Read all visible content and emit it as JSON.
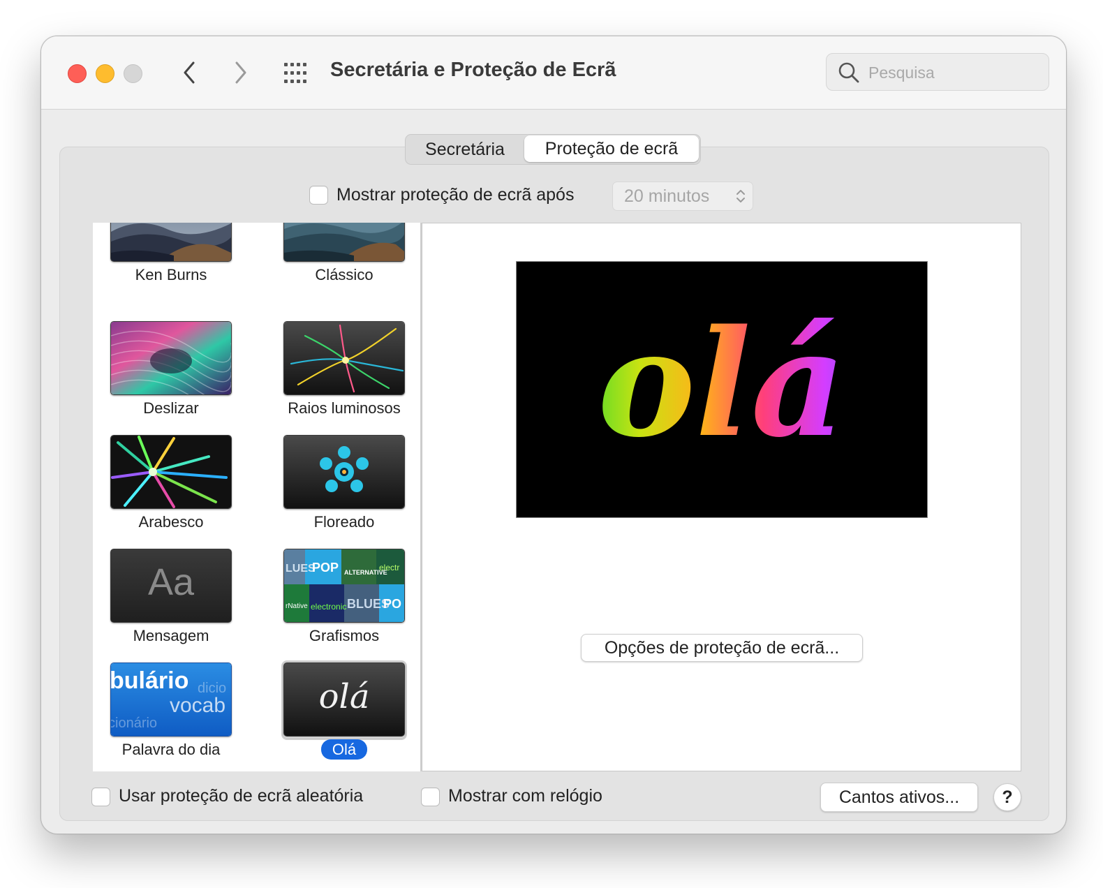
{
  "window": {
    "title": "Secretária e Proteção de Ecrã",
    "search_placeholder": "Pesquisa"
  },
  "tabs": [
    {
      "label": "Secretária",
      "selected": false
    },
    {
      "label": "Proteção de ecrã",
      "selected": true
    }
  ],
  "show_after": {
    "label": "Mostrar proteção de ecrã após",
    "checked": false,
    "select_value": "20 minutos"
  },
  "screensavers": [
    {
      "name": "Ken Burns",
      "icon": "mountain-landscape-thumbnail"
    },
    {
      "name": "Clássico",
      "icon": "mountain-landscape-thumbnail"
    },
    {
      "name": "Deslizar",
      "icon": "drift-thumbnail"
    },
    {
      "name": "Raios luminosos",
      "icon": "flurry-thumbnail"
    },
    {
      "name": "Arabesco",
      "icon": "arabesque-thumbnail"
    },
    {
      "name": "Floreado",
      "icon": "shell-thumbnail"
    },
    {
      "name": "Mensagem",
      "icon": "message-thumbnail",
      "text": "Aa"
    },
    {
      "name": "Grafismos",
      "icon": "album-artwork-thumbnail",
      "art_words": [
        "LUES",
        "POP",
        "ALTERNATIVE",
        "electr",
        "rNative",
        "electronic",
        "BLUES",
        "PO"
      ]
    },
    {
      "name": "Palavra do dia",
      "icon": "word-of-the-day-thumbnail",
      "art_words": [
        "bulário",
        "dicio",
        "vocab",
        "cionário"
      ]
    },
    {
      "name": "Olá",
      "icon": "hello-thumbnail",
      "text": "olá",
      "selected": true
    }
  ],
  "preview": {
    "text": "olá"
  },
  "options_button": "Opções de proteção de ecrã...",
  "random": {
    "label": "Usar proteção de ecrã aleatória",
    "checked": false
  },
  "clock": {
    "label": "Mostrar com relógio",
    "checked": false
  },
  "hot_corners_button": "Cantos ativos...",
  "help_button": "?",
  "colors": {
    "accent": "#1768e0",
    "close": "#fe5f57",
    "minimize": "#febc2e"
  }
}
